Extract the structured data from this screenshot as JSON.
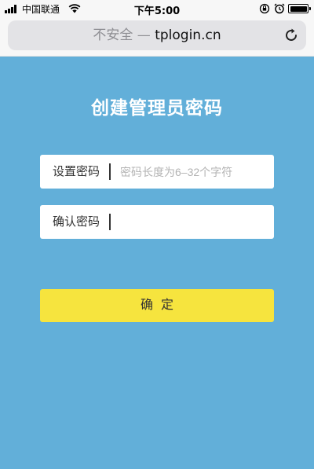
{
  "status_bar": {
    "carrier": "中国联通",
    "time": "下午5:00"
  },
  "browser": {
    "insecure_label": "不安全",
    "separator": "—",
    "domain": "tplogin.cn",
    "reload_icon": "reload-icon"
  },
  "form": {
    "title": "创建管理员密码",
    "password": {
      "label": "设置密码",
      "placeholder": "密码长度为6–32个字符",
      "value": ""
    },
    "confirm_password": {
      "label": "确认密码",
      "placeholder": "",
      "value": ""
    },
    "submit_label": "确定"
  },
  "colors": {
    "background": "#62afd9",
    "button": "#f6e43e",
    "title_text": "#ffffff"
  }
}
